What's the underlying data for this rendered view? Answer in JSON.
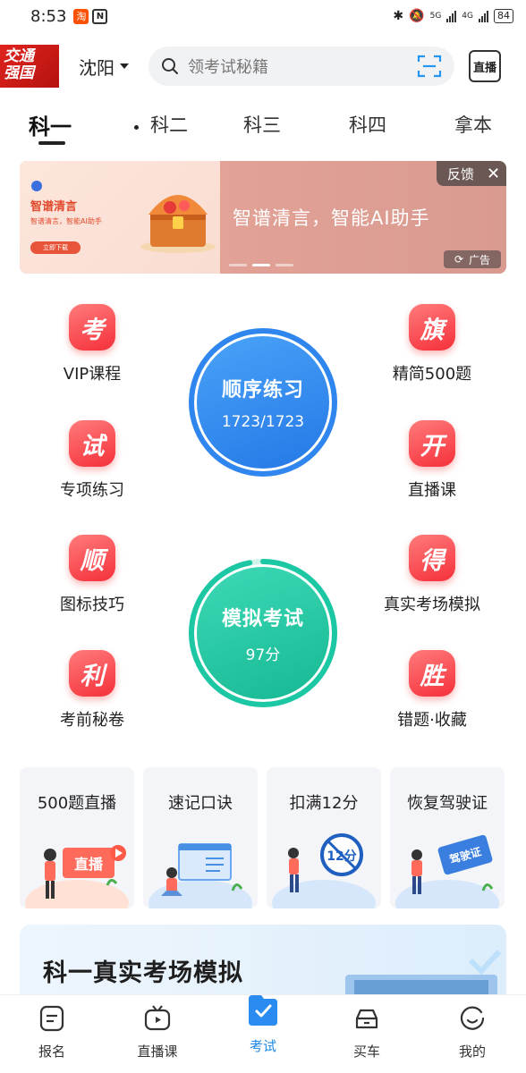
{
  "status_bar": {
    "time": "8:53",
    "app_icon_taobao": "淘",
    "app_icon_nfc": "N",
    "signal_1": "5G",
    "signal_2": "4G",
    "battery": "84"
  },
  "header": {
    "logo_line1": "交通",
    "logo_line2": "强国",
    "city": "沈阳",
    "search_placeholder": "领考试秘籍",
    "live_button": "直播"
  },
  "tabs": [
    {
      "label": "科一",
      "active": true
    },
    {
      "label": "科二"
    },
    {
      "label": "科三"
    },
    {
      "label": "科四"
    },
    {
      "label": "拿本"
    }
  ],
  "banner": {
    "left_title": "智谱清言",
    "left_sub": "智谱清言，智能AI助手",
    "left_button": "立即下载",
    "text": "智谱清言，智能AI助手",
    "feedback_label": "反馈",
    "ad_label": "广告"
  },
  "features_left": [
    {
      "badge": "考",
      "label": "VIP课程"
    },
    {
      "badge": "试",
      "label": "专项练习"
    },
    {
      "badge": "顺",
      "label": "图标技巧"
    },
    {
      "badge": "利",
      "label": "考前秘卷"
    }
  ],
  "features_right": [
    {
      "badge": "旗",
      "label": "精简500题"
    },
    {
      "badge": "开",
      "label": "直播课"
    },
    {
      "badge": "得",
      "label": "真实考场模拟"
    },
    {
      "badge": "胜",
      "label": "错题·收藏"
    }
  ],
  "practice_circle": {
    "title": "顺序练习",
    "progress_text": "1723/1723",
    "progress": 1.0
  },
  "exam_circle": {
    "title": "模拟考试",
    "score_text": "97分",
    "progress": 0.97
  },
  "cards": [
    {
      "label": "500题直播",
      "art_text": "直播"
    },
    {
      "label": "速记口诀"
    },
    {
      "label": "扣满12分",
      "art_text": "12分"
    },
    {
      "label": "恢复驾驶证",
      "art_text": "驾驶证"
    }
  ],
  "promo": {
    "title": "科一真实考场模拟"
  },
  "bottom_nav": [
    {
      "label": "报名"
    },
    {
      "label": "直播课"
    },
    {
      "label": "考试",
      "active": true
    },
    {
      "label": "买车"
    },
    {
      "label": "我的"
    }
  ],
  "colors": {
    "accent_blue": "#1e88e5",
    "badge_red": "#f5303a",
    "practice_blue": "#3d8ff0",
    "exam_green": "#1fc6a6"
  }
}
